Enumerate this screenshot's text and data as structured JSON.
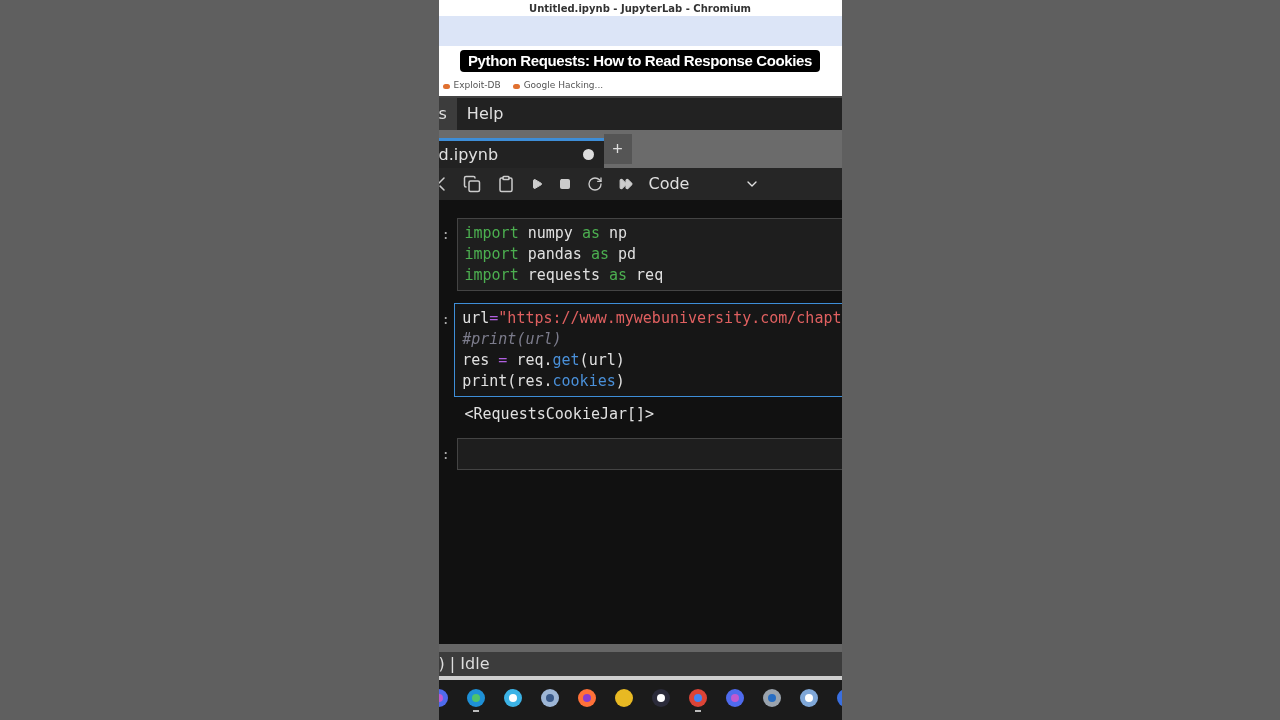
{
  "window": {
    "title": "Untitled.ipynb - JupyterLab - Chromium"
  },
  "caption": "Python Requests: How to Read Response Cookies",
  "bookmarks": [
    {
      "label": "Exploit-DB"
    },
    {
      "label": "Google Hacking..."
    }
  ],
  "menu": [
    {
      "label": "s",
      "selected": true
    },
    {
      "label": "Help",
      "selected": false
    }
  ],
  "tab": {
    "label": "d.ipynb",
    "modified": true,
    "add": "+"
  },
  "toolbar": {
    "cell_type": "Code"
  },
  "cells": [
    {
      "prompt": ":",
      "selected": false,
      "lines": [
        [
          {
            "text": "import",
            "kind": "keyword"
          },
          {
            "text": " numpy ",
            "kind": "plain"
          },
          {
            "text": "as",
            "kind": "keyword"
          },
          {
            "text": " np",
            "kind": "plain"
          }
        ],
        [
          {
            "text": "import",
            "kind": "keyword"
          },
          {
            "text": " pandas ",
            "kind": "plain"
          },
          {
            "text": "as",
            "kind": "keyword"
          },
          {
            "text": " pd",
            "kind": "plain"
          }
        ],
        [
          {
            "text": "import",
            "kind": "keyword"
          },
          {
            "text": " requests ",
            "kind": "plain"
          },
          {
            "text": "as",
            "kind": "keyword"
          },
          {
            "text": " req",
            "kind": "plain"
          }
        ]
      ]
    },
    {
      "prompt": ":",
      "selected": true,
      "output": "<RequestsCookieJar[]>",
      "lines": [
        [
          {
            "text": "url",
            "kind": "plain"
          },
          {
            "text": "=",
            "kind": "operator"
          },
          {
            "text": "\"https://www.mywebuniversity.com/chapt",
            "kind": "string"
          }
        ],
        [
          {
            "text": "#print(url)",
            "kind": "comment"
          }
        ],
        [
          {
            "text": "res ",
            "kind": "plain"
          },
          {
            "text": "=",
            "kind": "operator"
          },
          {
            "text": " req.",
            "kind": "plain"
          },
          {
            "text": "get",
            "kind": "attr"
          },
          {
            "text": "(url)",
            "kind": "plain"
          }
        ],
        [
          {
            "text": "print(res.",
            "kind": "plain"
          },
          {
            "text": "cookies",
            "kind": "attr"
          },
          {
            "text": ")",
            "kind": "plain"
          }
        ]
      ]
    },
    {
      "prompt": ":",
      "selected": false
    }
  ],
  "status_bar": {
    "text": ") | Idle"
  },
  "taskbar": [
    {
      "running": false
    },
    {
      "running": true
    },
    {
      "running": false
    },
    {
      "running": false
    },
    {
      "running": false
    },
    {
      "running": false
    },
    {
      "running": false
    },
    {
      "running": true
    },
    {
      "running": false
    },
    {
      "running": false
    },
    {
      "running": false
    },
    {
      "running": false
    }
  ]
}
